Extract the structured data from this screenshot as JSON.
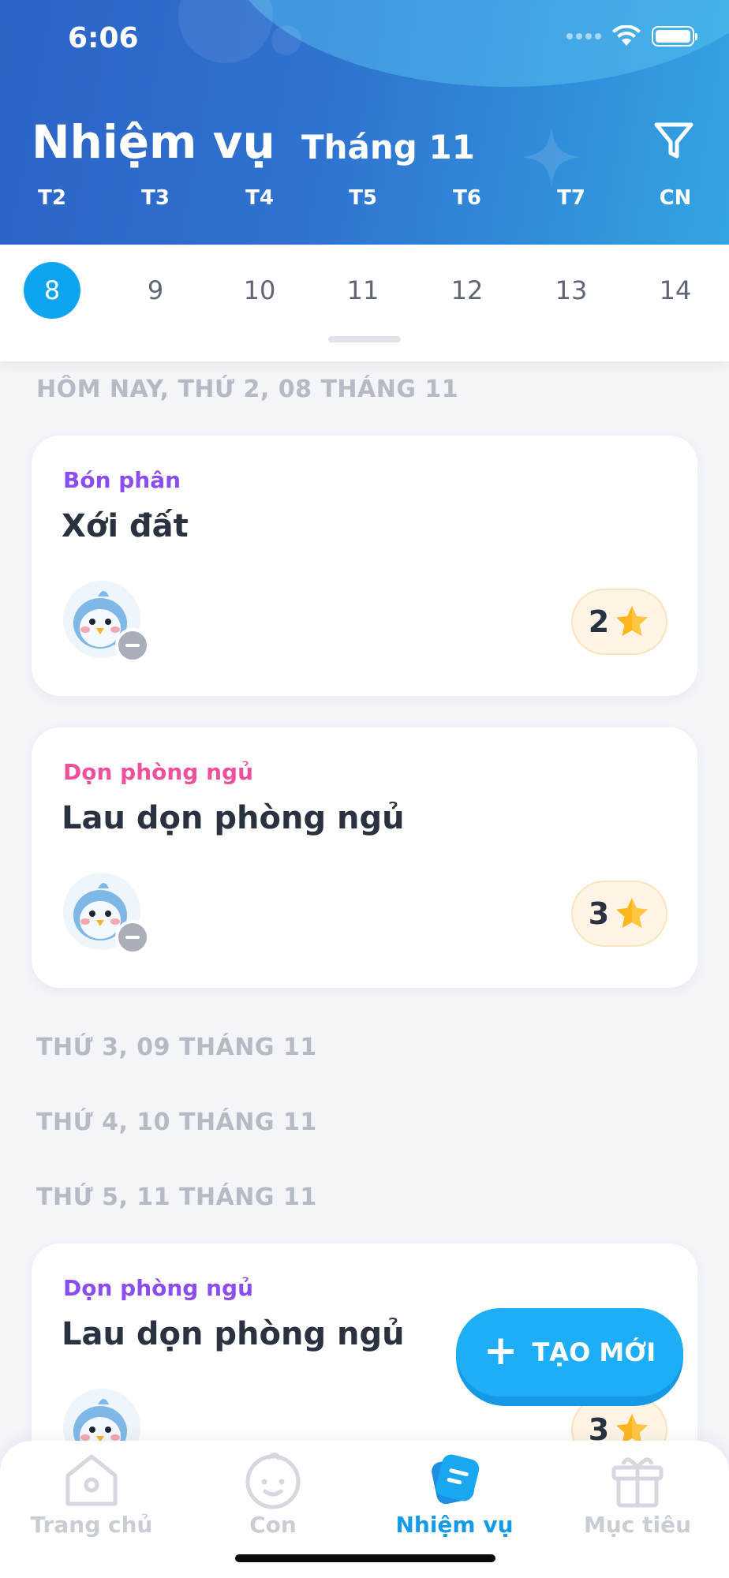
{
  "status_bar": {
    "time": "6:06"
  },
  "header": {
    "title": "Nhiệm vụ",
    "month": "Tháng 11"
  },
  "weekdays": [
    "T2",
    "T3",
    "T4",
    "T5",
    "T6",
    "T7",
    "CN"
  ],
  "dates": [
    {
      "label": "8",
      "active": true
    },
    {
      "label": "9",
      "active": false
    },
    {
      "label": "10",
      "active": false
    },
    {
      "label": "11",
      "active": false
    },
    {
      "label": "12",
      "active": false
    },
    {
      "label": "13",
      "active": false
    },
    {
      "label": "14",
      "active": false
    }
  ],
  "sections": [
    {
      "label": "HÔM NAY, THỨ 2, 08 THÁNG 11"
    },
    {
      "label": "THỨ 3, 09 THÁNG 11"
    },
    {
      "label": "THỨ 4, 10 THÁNG 11"
    },
    {
      "label": "THỨ 5, 11 THÁNG 11"
    }
  ],
  "tasks": [
    {
      "category": "Bón phân",
      "category_color": "#8A4DF0",
      "title": "Xới đất",
      "reward": "2"
    },
    {
      "category": "Dọn phòng ngủ",
      "category_color": "#F0509B",
      "title": "Lau dọn phòng ngủ",
      "reward": "3"
    },
    {
      "category": "Dọn phòng ngủ",
      "category_color": "#8A4DF0",
      "title": "Lau dọn phòng ngủ",
      "reward": "3"
    }
  ],
  "fab": {
    "icon": "plus-icon",
    "label": "TẠO MỚI"
  },
  "bottom_nav": [
    {
      "label": "Trang chủ",
      "icon": "home-icon",
      "active": false
    },
    {
      "label": "Con",
      "icon": "child-face-icon",
      "active": false
    },
    {
      "label": "Nhiệm vụ",
      "icon": "task-icon",
      "active": true
    },
    {
      "label": "Mục tiêu",
      "icon": "gift-icon",
      "active": false
    }
  ],
  "colors": {
    "accent": "#0EA5F0",
    "header_start": "#2C63C6",
    "header_end": "#33A4E2",
    "star": "#FFB61E"
  }
}
